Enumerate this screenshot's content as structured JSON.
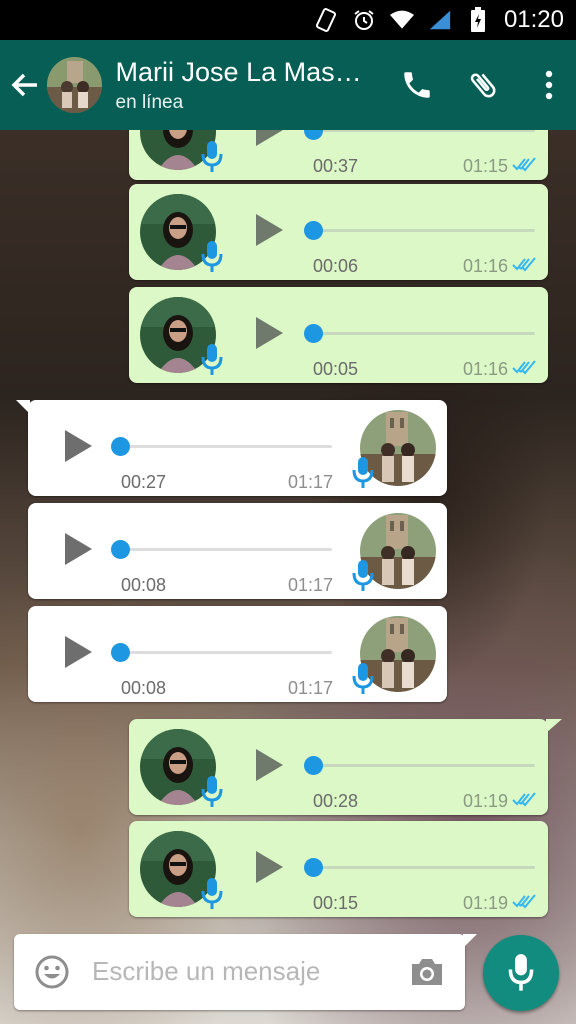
{
  "status_bar": {
    "time": "01:20",
    "icons": [
      "vibrate-icon",
      "alarm-icon",
      "wifi-icon",
      "signal-icon",
      "battery-icon"
    ]
  },
  "header": {
    "back_icon": "arrow-left-icon",
    "contact_name": "Marii Jose La Mas…",
    "status": "en línea",
    "actions": [
      "phone-icon",
      "paperclip-icon",
      "more-vert-icon"
    ]
  },
  "messages": [
    {
      "direction": "out",
      "duration": "00:37",
      "time": "01:15",
      "progress": 0,
      "read": true
    },
    {
      "direction": "out",
      "duration": "00:06",
      "time": "01:16",
      "progress": 0,
      "read": true
    },
    {
      "direction": "out",
      "duration": "00:05",
      "time": "01:16",
      "progress": 0,
      "read": true
    },
    {
      "direction": "in",
      "duration": "00:27",
      "time": "01:17",
      "progress": 0
    },
    {
      "direction": "in",
      "duration": "00:08",
      "time": "01:17",
      "progress": 0
    },
    {
      "direction": "in",
      "duration": "00:08",
      "time": "01:17",
      "progress": 0
    },
    {
      "direction": "out",
      "duration": "00:28",
      "time": "01:19",
      "progress": 0,
      "read": true
    },
    {
      "direction": "out",
      "duration": "00:15",
      "time": "01:19",
      "progress": 0,
      "read": true
    }
  ],
  "composer": {
    "placeholder": "Escribe un mensaje",
    "emoji_icon": "emoji-icon",
    "camera_icon": "camera-icon",
    "send_icon": "microphone-icon"
  },
  "colors": {
    "header": "#075e54",
    "outgoing_bubble": "#dcf8c6",
    "incoming_bubble": "#ffffff",
    "progress_knob": "#1e97e3",
    "read_ticks": "#34b7f1",
    "mic_button": "#128c7e"
  }
}
